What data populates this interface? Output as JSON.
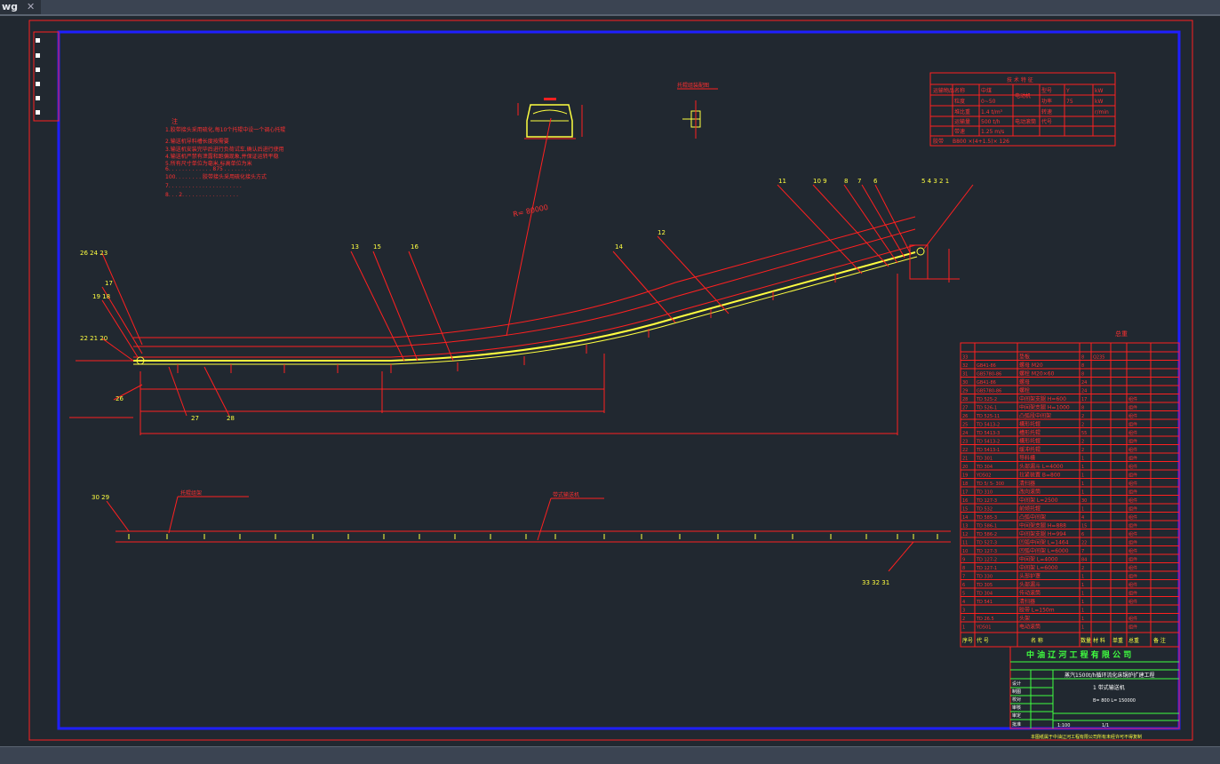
{
  "tab": {
    "label": "wg",
    "close": "✕"
  },
  "drawing": {
    "notes_title": "注",
    "notes": [
      "1.胶带接头采用硫化,每10个托辊中设一个调心托辊",
      "2.输送机导料槽长度按需要",
      "3.输送机安装完毕后进行负荷试车,确认后进行使用",
      "4.输送机严禁有泄露和跑偏现象,并保证运转平稳",
      "5.所有尺寸单位为毫米,标高单位为米",
      "6. . . . . . . . . . . . . 875 . . . . . . . .",
      "   100. . . . . . . . 胶带接头采用硫化接头方式",
      "7. . . . . . . . . . . . . . . . . . . . . .",
      "8. . . 2. . . . . . . . . . . . . . . . ."
    ],
    "radius_label": "R= 80000",
    "detail_label": "托辊组装配图",
    "tech_table": {
      "title": "技 术 特 征",
      "rows": [
        [
          "运输物品",
          "名称",
          "中煤",
          "电动机",
          "型号",
          "Y",
          "kW"
        ],
        [
          "",
          "粒度",
          "0~50",
          "",
          "功率",
          "75",
          "kW"
        ],
        [
          "",
          "堆比重",
          "1.4 t/m³",
          "",
          "转速",
          "",
          "r/min"
        ],
        [
          "",
          "运输量",
          "500 t/h",
          "电动滚筒",
          "代号",
          "",
          ""
        ],
        [
          "",
          "带速",
          "1.25 m/s",
          "",
          "",
          "",
          ""
        ],
        [
          "胶带",
          "B800 ×(4+1.5)× 126",
          "",
          "",
          "",
          "",
          ""
        ]
      ]
    },
    "callouts_top": [
      "11",
      "10 9",
      "8",
      "7",
      "6",
      "5 4 3 2 1",
      "12",
      "13",
      "14",
      "15",
      "16",
      "17",
      "19 18",
      "22 21 20",
      "26 24 23",
      "26",
      "27",
      "28"
    ],
    "callouts_bottom": [
      "30 29",
      "33 32 31"
    ],
    "plan_labels": [
      "托辊组架",
      "带式输送机"
    ],
    "bom_title": "总重",
    "bom_header": [
      "序号",
      "代 号",
      "名 称",
      "数量",
      "材 料",
      "单重",
      "总重",
      "备 注"
    ],
    "bom_rows": [
      [
        "33",
        "",
        "垫板",
        "8",
        "Q235",
        "",
        ""
      ],
      [
        "32",
        "GB41-86",
        "螺母 M20",
        "8",
        "",
        "",
        ""
      ],
      [
        "31",
        "GB5780-86",
        "螺栓 M20×60",
        "8",
        "",
        "",
        ""
      ],
      [
        "30",
        "GB41-86",
        "螺母",
        "24",
        "",
        "",
        ""
      ],
      [
        "29",
        "GB5780-86",
        "螺栓",
        "24",
        "",
        "",
        ""
      ],
      [
        "28",
        "TD 525-2",
        "中间架支腿 H=600",
        "17",
        "",
        "",
        "组件"
      ],
      [
        "27",
        "TD 526-1",
        "中间架支腿 H=1000",
        "8",
        "",
        "",
        "组件"
      ],
      [
        "26",
        "TD 525-11",
        "凸弧段中间架",
        "2",
        "",
        "",
        "组件"
      ],
      [
        "25",
        "TD 5413-2",
        "槽形托辊",
        "2",
        "",
        "",
        "组件"
      ],
      [
        "24",
        "TD 5413-3",
        "槽形托辊",
        "55",
        "",
        "",
        "组件"
      ],
      [
        "23",
        "TD 5413-2",
        "槽形托辊",
        "2",
        "",
        "",
        "组件"
      ],
      [
        "22",
        "TD 5413-1",
        "缓冲托辊",
        "2",
        "",
        "",
        "组件"
      ],
      [
        "21",
        "TD 301",
        "导料槽",
        "1",
        "",
        "",
        "组件"
      ],
      [
        "20",
        "TD 304",
        "头部漏斗 L=4000",
        "1",
        "",
        "",
        "组件"
      ],
      [
        "19",
        "YD502",
        "拉紧装置 B=800",
        "1",
        "",
        "",
        "组件"
      ],
      [
        "18",
        "TD 5/ 5- 300",
        "清扫器",
        "1",
        "",
        "",
        "组件"
      ],
      [
        "17",
        "TD 310",
        "改向滚筒",
        "1",
        "",
        "",
        "组件"
      ],
      [
        "16",
        "TD 127-3",
        "中间架 L=2500",
        "30",
        "",
        "",
        "组件"
      ],
      [
        "15",
        "TD 532",
        "前倾托辊",
        "1",
        "",
        "",
        "组件"
      ],
      [
        "14",
        "TD 585-3",
        "凸弧中间架",
        "4",
        "",
        "",
        "组件"
      ],
      [
        "13",
        "TD 586-1",
        "中间架支腿 H=888",
        "15",
        "",
        "",
        "组件"
      ],
      [
        "12",
        "TD 586-2",
        "中间架支腿 H=994",
        "6",
        "",
        "",
        "组件"
      ],
      [
        "11",
        "TD 527-3",
        "凹弧中间架 L=1464",
        "22",
        "",
        "",
        "组件"
      ],
      [
        "10",
        "TD 127-3",
        "凹弧中间架 L=6000",
        "7",
        "",
        "",
        "组件"
      ],
      [
        "9",
        "TD 127-2",
        "中间架 L=4000",
        "84",
        "",
        "",
        "组件"
      ],
      [
        "8",
        "TD 127-1",
        "中间架 L=6000",
        "2",
        "",
        "",
        "组件"
      ],
      [
        "7",
        "TD 330",
        "头部护罩",
        "1",
        "",
        "",
        "组件"
      ],
      [
        "6",
        "TD 305",
        "头部漏斗",
        "1",
        "",
        "",
        "组件"
      ],
      [
        "5",
        "TD 304",
        "传动滚筒",
        "1",
        "",
        "",
        "组件"
      ],
      [
        "4",
        "TD 541",
        "清扫器",
        "1",
        "",
        "",
        "组件"
      ],
      [
        "3",
        "",
        "胶带 L=150m",
        "1",
        "",
        "",
        ""
      ],
      [
        "2",
        "TD 26.5",
        "头架",
        "1",
        "",
        "",
        "组件"
      ],
      [
        "1",
        "YD501",
        "电动滚筒",
        "1",
        "",
        "",
        "组件"
      ]
    ],
    "company": "中 油 辽 河 工 程 有 限 公 司",
    "project": "蒸汽1500t/h循环流化床锅炉扩建工程",
    "drawing_title": "1   带式输送机",
    "drawing_params": "B= 800   L= 150000",
    "title_rows": [
      "设计",
      "制图",
      "校对",
      "审核",
      "审定",
      "批准"
    ],
    "scale": "1:100",
    "sheet_no": "1/1",
    "footer_note": "本图纸属于中油辽河工程有限公司所有未经许可不得复制"
  }
}
